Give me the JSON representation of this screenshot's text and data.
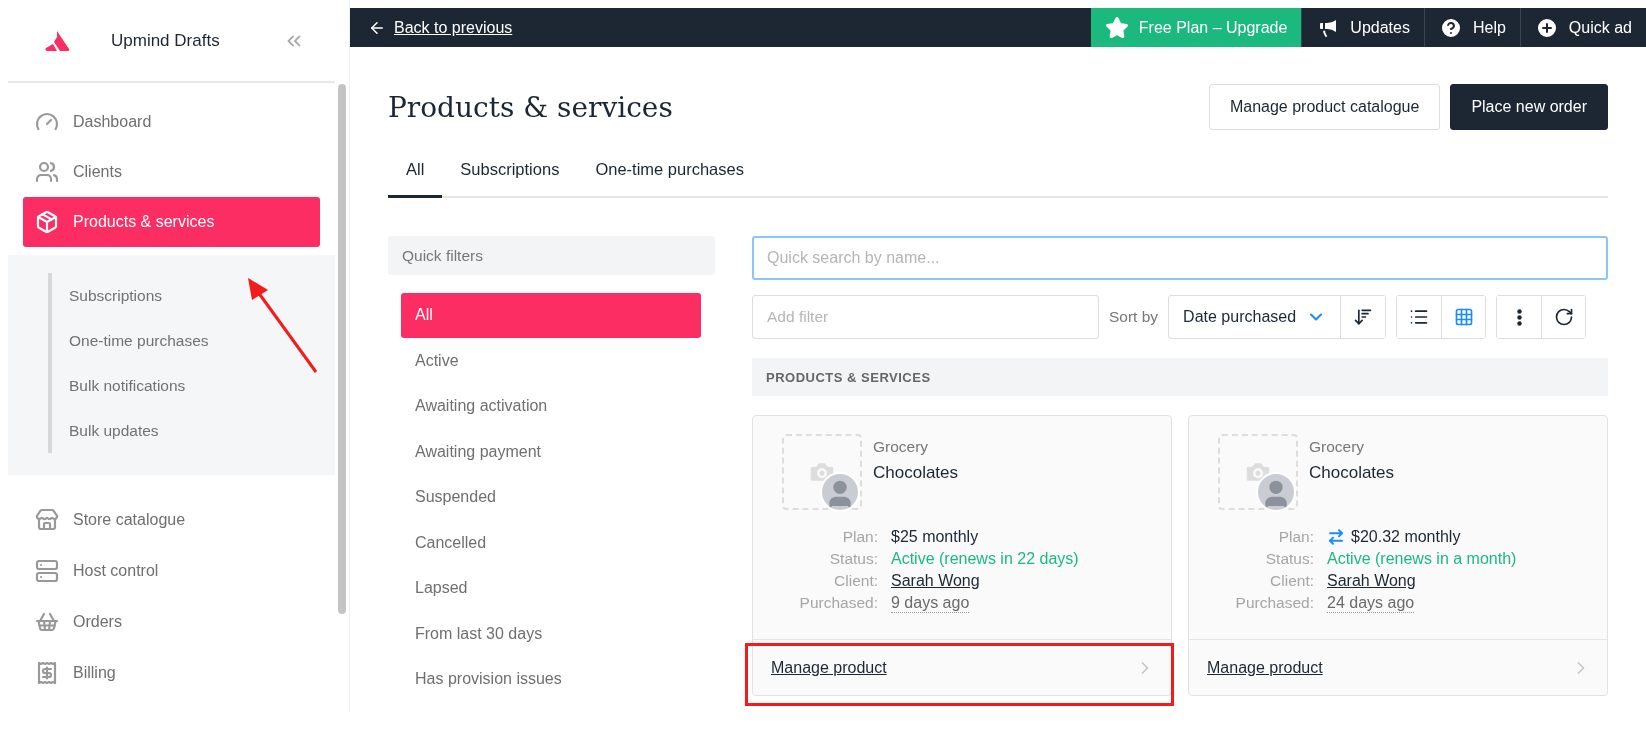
{
  "sidebar": {
    "brand": "Upmind Drafts",
    "items": [
      {
        "label": "Dashboard",
        "selected": false
      },
      {
        "label": "Clients",
        "selected": false
      },
      {
        "label": "Products & services",
        "selected": true
      }
    ],
    "subitems": [
      {
        "label": "Subscriptions"
      },
      {
        "label": "One-time purchases"
      },
      {
        "label": "Bulk notifications"
      },
      {
        "label": "Bulk updates"
      }
    ],
    "lower_items": [
      {
        "label": "Store catalogue"
      },
      {
        "label": "Host control"
      },
      {
        "label": "Orders"
      },
      {
        "label": "Billing"
      }
    ]
  },
  "top_bar": {
    "back_link": "Back to previous",
    "items": [
      {
        "label": "Free Plan – Upgrade",
        "kind": "upgrade"
      },
      {
        "label": "Updates",
        "kind": "updates"
      },
      {
        "label": "Help",
        "kind": "help"
      },
      {
        "label": "Quick ad",
        "kind": "quick-add"
      }
    ]
  },
  "page": {
    "title": "Products & services",
    "actions": [
      {
        "label": "Manage product catalogue",
        "kind": "secondary"
      },
      {
        "label": "Place new order",
        "kind": "primary"
      }
    ]
  },
  "tabs": [
    {
      "label": "All",
      "selected": true
    },
    {
      "label": "Subscriptions",
      "selected": false
    },
    {
      "label": "One-time purchases",
      "selected": false
    }
  ],
  "quick_filters": {
    "title": "Quick filters",
    "items": [
      {
        "label": "All",
        "selected": true
      },
      {
        "label": "Active",
        "selected": false
      },
      {
        "label": "Awaiting activation",
        "selected": false
      },
      {
        "label": "Awaiting payment",
        "selected": false
      },
      {
        "label": "Suspended",
        "selected": false
      },
      {
        "label": "Cancelled",
        "selected": false
      },
      {
        "label": "Lapsed",
        "selected": false
      },
      {
        "label": "From last 30 days",
        "selected": false
      },
      {
        "label": "Has provision issues",
        "selected": false
      }
    ]
  },
  "search": {
    "placeholder": "Quick search by name..."
  },
  "filter": {
    "placeholder": "Add filter"
  },
  "sort": {
    "label": "Sort by",
    "value": "Date purchased"
  },
  "views": [
    {
      "kind": "list",
      "selected": false
    },
    {
      "kind": "grid",
      "selected": true
    }
  ],
  "section_title": "PRODUCTS & SERVICES",
  "cards": [
    {
      "category": "Grocery",
      "name": "Chocolates",
      "recurring": false,
      "fields": [
        {
          "label": "Plan:",
          "value": "$25 monthly",
          "kind": "plain"
        },
        {
          "label": "Status:",
          "value": "Active (renews in 22 days)",
          "kind": "status"
        },
        {
          "label": "Client:",
          "value": "Sarah Wong",
          "kind": "link"
        },
        {
          "label": "Purchased:",
          "value": "9 days ago",
          "kind": "time"
        }
      ],
      "action": "Manage product"
    },
    {
      "category": "Grocery",
      "name": "Chocolates",
      "recurring": true,
      "fields": [
        {
          "label": "Plan:",
          "value": "$20.32 monthly",
          "kind": "plain"
        },
        {
          "label": "Status:",
          "value": "Active (renews in a month)",
          "kind": "status"
        },
        {
          "label": "Client:",
          "value": "Sarah Wong",
          "kind": "link"
        },
        {
          "label": "Purchased:",
          "value": "24 days ago",
          "kind": "time"
        }
      ],
      "action": "Manage product"
    }
  ]
}
